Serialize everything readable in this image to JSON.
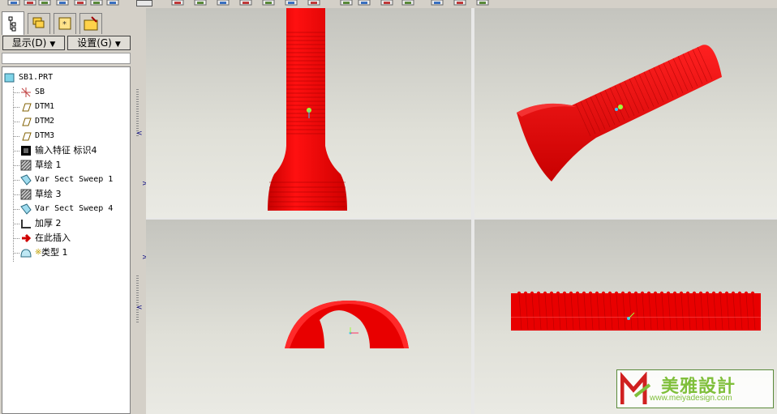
{
  "toolbar": {
    "icons": [
      "sketch-view-icon",
      "eye-icon",
      "orient-icon",
      "repaint-icon",
      "edit-icon",
      "select-icon",
      "datum-plane-icon",
      "datum-axis-icon",
      "datum-point-icon",
      "datum-csys-icon",
      "spin-center-icon",
      "view-manager-icon",
      "delete-icon",
      "delete-all-icon",
      "model-tree-icon",
      "window-icon",
      "layer-icon",
      "appearance-icon",
      "sketch-icon",
      "drawing-icon",
      "info-icon"
    ]
  },
  "left_panel": {
    "tabs": [
      "model-tree-tab",
      "layer-tab",
      "favorites-tab",
      "folder-tab"
    ],
    "show_label": "显示(D)",
    "settings_label": "设置(G)",
    "tree": [
      {
        "label": "SB1.PRT",
        "icon": "part-icon",
        "mono": true
      },
      {
        "label": "SB",
        "icon": "csys-icon",
        "mono": true
      },
      {
        "label": "DTM1",
        "icon": "datum-plane-icon",
        "mono": true
      },
      {
        "label": "DTM2",
        "icon": "datum-plane-icon",
        "mono": true
      },
      {
        "label": "DTM3",
        "icon": "datum-plane-icon",
        "mono": true
      },
      {
        "label": "输入特征 标识4",
        "icon": "import-feature-icon",
        "mono": false
      },
      {
        "label": "草绘 1",
        "icon": "sketch-icon",
        "mono": false
      },
      {
        "label": "Var Sect Sweep 1",
        "icon": "sweep-icon",
        "mono": true
      },
      {
        "label": "草绘 3",
        "icon": "sketch-icon",
        "mono": false
      },
      {
        "label": "Var Sect Sweep 4",
        "icon": "sweep-icon",
        "mono": true
      },
      {
        "label": "加厚 2",
        "icon": "thicken-icon",
        "mono": false
      },
      {
        "label": "在此插入",
        "icon": "insert-here-arrow-icon",
        "mono": false
      },
      {
        "label": "类型 1",
        "icon": "style-feature-icon",
        "mono": false
      }
    ]
  },
  "viewports": [
    "front-view",
    "isometric-view",
    "top-view",
    "side-view"
  ],
  "colors": {
    "model": "#e80000",
    "model_dark": "#b00000",
    "bg_top": "#c4c4be",
    "bg_bottom": "#eaeae4"
  },
  "watermark": {
    "chinese": "美雅設計",
    "url": "www.meiyadesign.com"
  }
}
